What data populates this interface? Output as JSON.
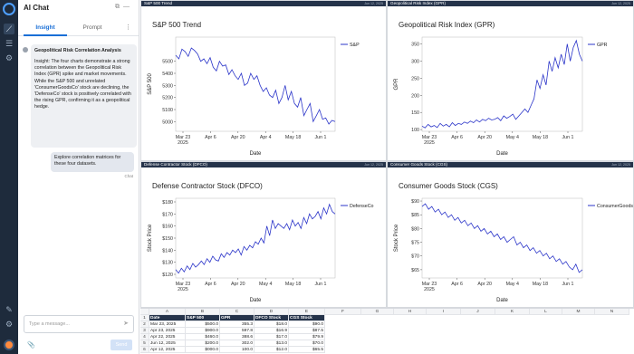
{
  "chat": {
    "title": "AI Chat",
    "tabs": [
      "Insight",
      "Prompt"
    ],
    "message_title": "Geopolitical Risk Correlation Analysis",
    "message_body": "Insight: The four charts demonstrate a strong correlation between the Geopolitical Risk Index (GPR) spike and market movements. While the S&P 500 and unrelated 'ConsumerGoodsCo' stock are declining, the 'DefenseCo' stock is positively correlated with the rising GPR, confirming it as a geopolitical hedge.",
    "user_message": "Explore correlation matrices for these four datasets.",
    "sender": "Chat",
    "input_placeholder": "Type a message...",
    "send_label": "Send",
    "icons": [
      "logo-icon",
      "chart-icon",
      "list-icon",
      "settings-icon",
      "tools-icon",
      "gear-icon",
      "user-avatar-icon"
    ]
  },
  "panels": [
    {
      "header": "S&P 500 Trend",
      "timestamp": "Jun 12, 2025"
    },
    {
      "header": "Geopolitical Risk Index (GPR)",
      "timestamp": "Jun 12, 2025"
    },
    {
      "header": "Defense Contractor Stock (DFCO)",
      "timestamp": "Jun 12, 2025"
    },
    {
      "header": "Consumer Goods Stock (CGS)",
      "timestamp": "Jun 12, 2025"
    }
  ],
  "chart_data": [
    {
      "type": "line",
      "title": "S&P 500 Trend",
      "xlabel": "Date",
      "ylabel": "S&P 500",
      "series": [
        {
          "name": "S&P",
          "color": "#2b35c9",
          "values": [
            5550,
            5520,
            5600,
            5580,
            5540,
            5610,
            5590,
            5560,
            5500,
            5520,
            5480,
            5530,
            5450,
            5420,
            5500,
            5460,
            5470,
            5390,
            5430,
            5380,
            5350,
            5400,
            5300,
            5320,
            5400,
            5350,
            5380,
            5300,
            5250,
            5280,
            5220,
            5200,
            5260,
            5150,
            5200,
            5300,
            5180,
            5250,
            5150,
            5120,
            5200,
            5050,
            5100,
            5150,
            5000,
            5050,
            5100,
            5020,
            5030,
            4980,
            5010,
            5000
          ]
        }
      ],
      "ylim": [
        4920,
        5700
      ],
      "yticks": [
        "5500",
        "5400",
        "5300",
        "5200",
        "5100",
        "5000"
      ],
      "xticks": [
        "Mar 23\n2025",
        "Apr 6",
        "Apr 20",
        "Apr 4",
        "May 18",
        "Jun 1"
      ]
    },
    {
      "type": "line",
      "title": "Geopolitical Risk Index (GPR)",
      "xlabel": "Date",
      "ylabel": "GPR",
      "series": [
        {
          "name": "GPR",
          "color": "#2b35c9",
          "values": [
            110,
            105,
            115,
            108,
            112,
            106,
            118,
            110,
            115,
            108,
            120,
            112,
            118,
            115,
            122,
            118,
            125,
            120,
            128,
            122,
            130,
            126,
            133,
            128,
            130,
            135,
            126,
            140,
            133,
            138,
            145,
            130,
            140,
            150,
            160,
            150,
            170,
            190,
            245,
            220,
            260,
            230,
            300,
            270,
            310,
            280,
            320,
            290,
            350,
            300,
            340,
            360,
            320,
            300
          ]
        }
      ],
      "ylim": [
        95,
        370
      ],
      "yticks": [
        "350",
        "300",
        "250",
        "200",
        "150",
        "100"
      ],
      "xticks": [
        "Mar 23\n2025",
        "Apr 6",
        "Apr 20",
        "May 4",
        "May 18",
        "Jun 1"
      ]
    },
    {
      "type": "line",
      "title": "Defense Contractor Stock (DFCO)",
      "xlabel": "Date",
      "ylabel": "Stock Price",
      "series": [
        {
          "name": "DefenseCo",
          "color": "#2b35c9",
          "values": [
            124,
            121,
            125,
            122,
            127,
            124,
            129,
            126,
            128,
            131,
            128,
            133,
            130,
            135,
            132,
            131,
            137,
            134,
            138,
            136,
            140,
            138,
            141,
            136,
            143,
            140,
            144,
            142,
            147,
            145,
            150,
            146,
            160,
            152,
            165,
            158,
            162,
            160,
            158,
            162,
            157,
            165,
            160,
            163,
            158,
            167,
            162,
            170,
            166,
            168,
            172,
            166,
            175,
            170,
            178,
            172,
            170
          ]
        }
      ],
      "ylim": [
        117,
        183
      ],
      "yticks": [
        "$180",
        "$170",
        "$160",
        "$150",
        "$140",
        "$130",
        "$120"
      ],
      "xticks": [
        "Mar 23\n2025",
        "Apr 6",
        "Apr 20",
        "May 4",
        "May 18",
        "Jun 1"
      ]
    },
    {
      "type": "line",
      "title": "Consumer Goods Stock (CGS)",
      "xlabel": "Date",
      "ylabel": "Stock Price",
      "series": [
        {
          "name": "ConsumerGoodsCo",
          "color": "#2b35c9",
          "values": [
            88,
            89,
            87,
            88,
            86,
            87,
            85,
            86,
            84,
            85,
            83,
            84,
            82,
            83,
            81,
            82,
            80,
            81,
            79,
            80,
            78,
            79,
            77,
            78,
            76,
            77,
            75,
            76,
            77,
            74,
            75,
            73,
            74,
            72,
            73,
            71,
            72,
            70,
            71,
            69,
            70,
            68,
            69,
            67,
            68,
            66,
            65,
            67,
            64,
            65
          ]
        }
      ],
      "ylim": [
        62,
        91
      ],
      "yticks": [
        "$90",
        "$85",
        "$80",
        "$75",
        "$70",
        "$65"
      ],
      "xticks": [
        "Mar 23\n2025",
        "Apr 6",
        "Apr 20",
        "May 4",
        "May 18",
        "Jun 1"
      ]
    }
  ],
  "sheet": {
    "columns": [
      "A",
      "B",
      "C",
      "D",
      "E",
      "F",
      "G",
      "H",
      "I",
      "J",
      "K",
      "L",
      "M",
      "N"
    ],
    "headers": [
      "Date",
      "S&P 500",
      "GPR",
      "DFCO Stock",
      "CGS Stock"
    ],
    "rows": [
      [
        "Mar 23, 2025",
        "$500.0",
        "355.3",
        "$18.0",
        "$90.0"
      ],
      [
        "Apr 23, 2025",
        "$900.0",
        "597.8",
        "$16.9",
        "$87.5"
      ],
      [
        "Apr 22, 2025",
        "$460.0",
        "388.6",
        "$17.0",
        "$79.9"
      ],
      [
        "Jun 12, 2025",
        "$200.0",
        "302.0",
        "$13.0",
        "$70.0"
      ],
      [
        "Apr 12, 2025",
        "$000.0",
        "100.0",
        "$12.0",
        "$65.5"
      ]
    ]
  }
}
